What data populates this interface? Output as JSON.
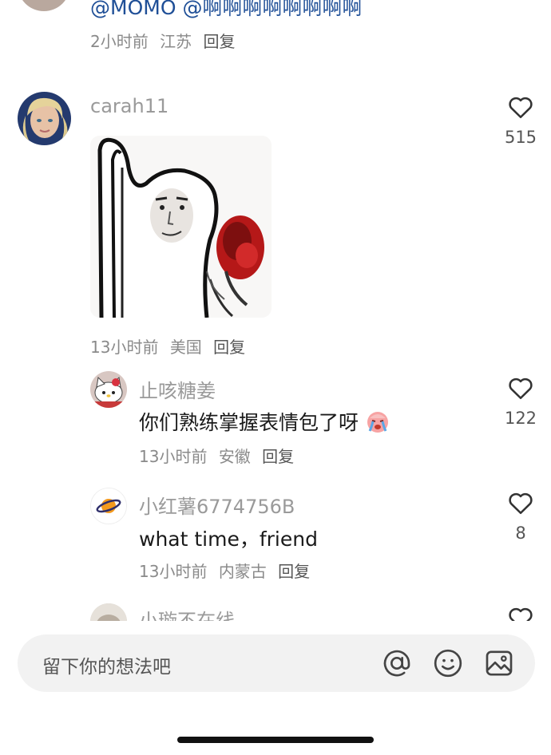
{
  "prev_comment": {
    "mention": "@MOMO",
    "text": "@啊啊啊啊啊啊啊啊",
    "time": "2小时前",
    "location": "江苏",
    "reply": "回复"
  },
  "comments": [
    {
      "username": "carah11",
      "time": "13小时前",
      "location": "美国",
      "reply": "回复",
      "likes": "515",
      "has_image": true
    }
  ],
  "replies": [
    {
      "username": "止咳糖姜",
      "text": "你们熟练掌握表情包了呀",
      "emoji": "crying-face",
      "time": "13小时前",
      "location": "安徽",
      "reply": "回复",
      "likes": "122"
    },
    {
      "username": "小红薯6774756B",
      "text": "what time，friend",
      "time": "13小时前",
      "location": "内蒙古",
      "reply": "回复",
      "likes": "8"
    },
    {
      "username": "小璇不在线"
    }
  ],
  "input": {
    "placeholder": "留下你的想法吧"
  },
  "icons": {
    "like": "heart-outline-icon",
    "mention": "at-icon",
    "emoji": "smiley-icon",
    "image": "image-icon"
  },
  "colors": {
    "mention_blue": "#1f4f97",
    "meta_gray": "#8a8a8a",
    "input_bg": "#f2f2f2"
  }
}
